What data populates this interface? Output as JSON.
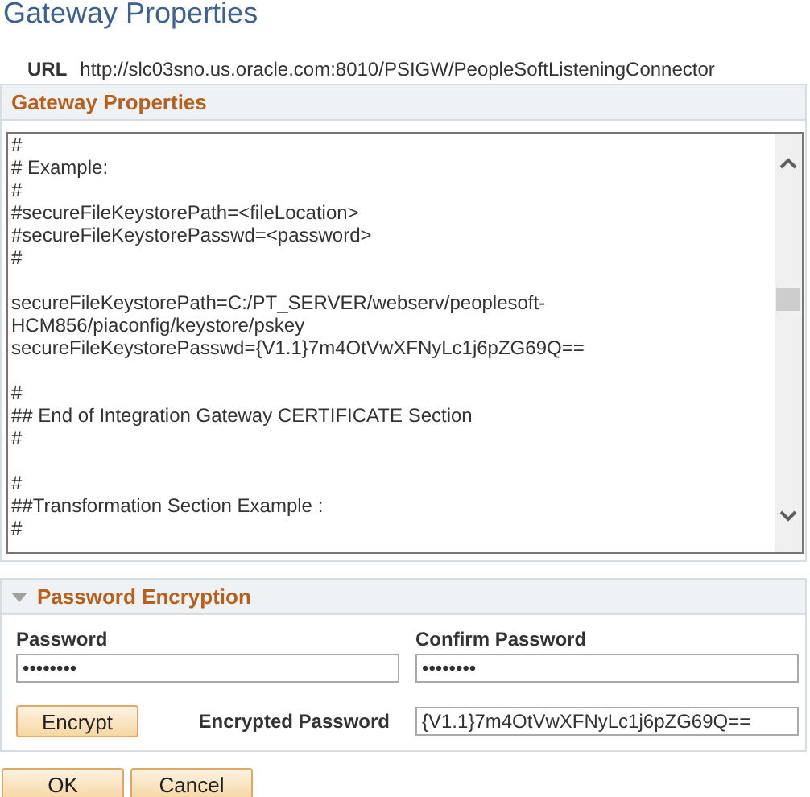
{
  "page_title": "Gateway Properties",
  "url": {
    "label": "URL",
    "value": "http://slc03sno.us.oracle.com:8010/PSIGW/PeopleSoftListeningConnector"
  },
  "gateway_section": {
    "title": "Gateway Properties",
    "blocks": [
      [
        "#",
        "# Example:",
        "#",
        "#secureFileKeystorePath=<fileLocation>",
        "#secureFileKeystorePasswd=<password>",
        "#"
      ],
      [
        "secureFileKeystorePath=C:/PT_SERVER/webserv/peoplesoft-HCM856/piaconfig/keystore/pskey",
        "secureFileKeystorePasswd={V1.1}7m4OtVwXFNyLc1j6pZG69Q=="
      ],
      [
        "#",
        "## End of Integration Gateway CERTIFICATE Section",
        "#"
      ],
      [
        "#",
        "##Transformation Section Example :",
        "#"
      ]
    ]
  },
  "password_section": {
    "title": "Password Encryption",
    "expanded": true,
    "password": {
      "label": "Password",
      "value": "••••••••"
    },
    "confirm_password": {
      "label": "Confirm Password",
      "value": "••••••••"
    },
    "encrypt_button": "Encrypt",
    "encrypted_password": {
      "label": "Encrypted Password",
      "value": "{V1.1}7m4OtVwXFNyLc1j6pZG69Q=="
    }
  },
  "buttons": [
    "OK",
    "Cancel"
  ]
}
